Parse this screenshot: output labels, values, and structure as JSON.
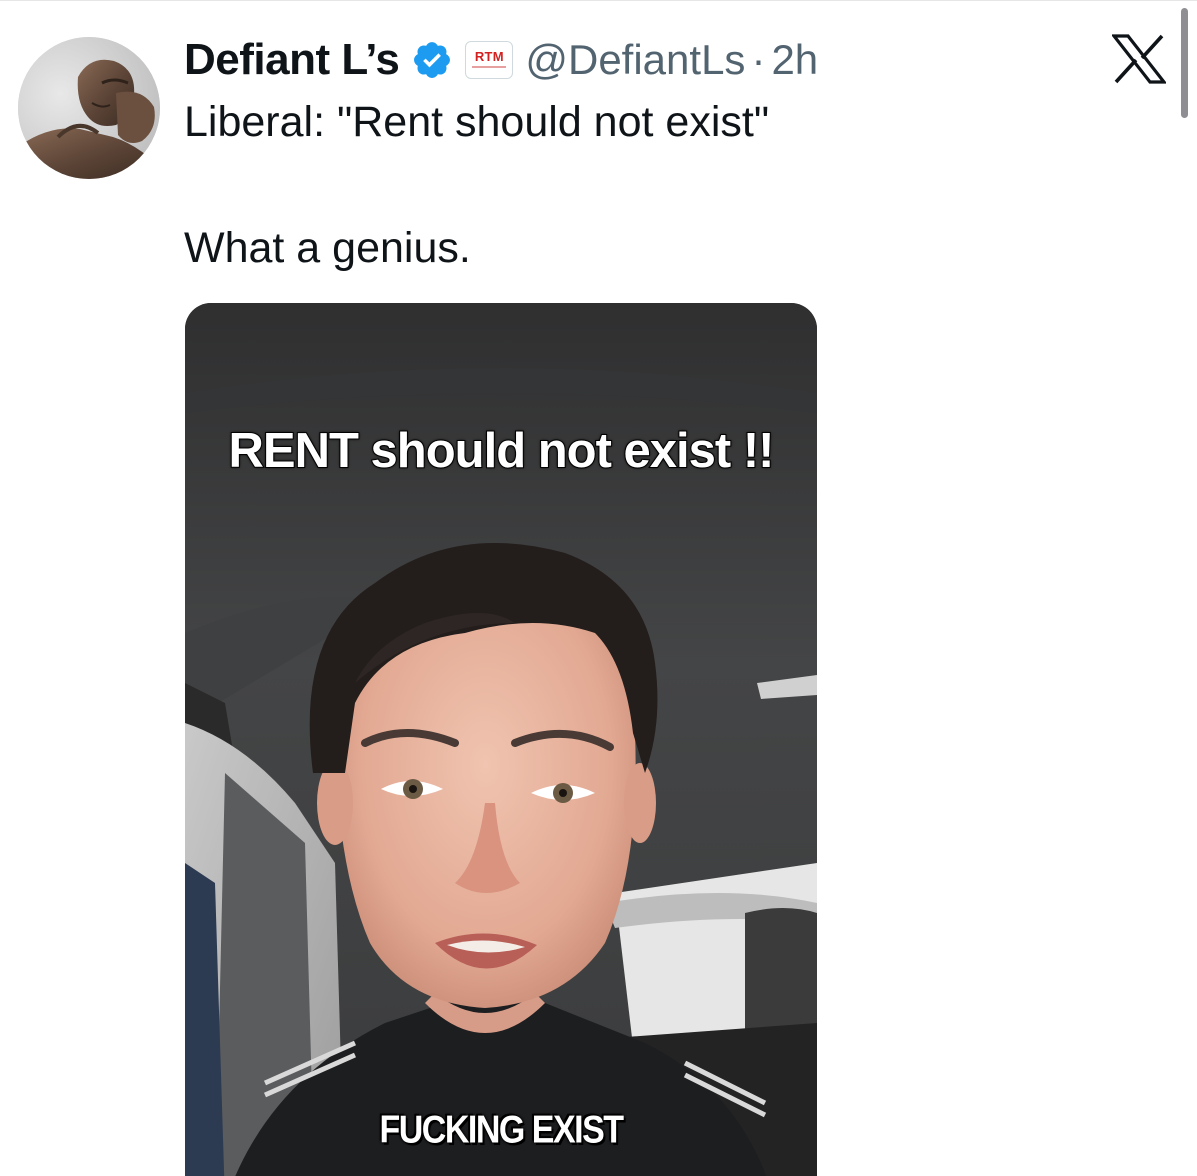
{
  "post": {
    "display_name": "Defiant L’s",
    "verified_icon": "verified-badge-icon",
    "affiliate_badge": "RTM",
    "handle": "@DefiantLs",
    "separator": "·",
    "time": "2h",
    "text_line1": "Liberal: \"Rent should not exist\"",
    "text_line2": "What a genius."
  },
  "media": {
    "caption_top": "RENT should not exist !!",
    "caption_bottom": "FUCKING EXIST"
  },
  "header": {
    "logo_icon": "x-logo-icon"
  },
  "colors": {
    "verified_blue": "#1d9bf0",
    "secondary_text": "#536471",
    "badge_red": "#d32020"
  }
}
